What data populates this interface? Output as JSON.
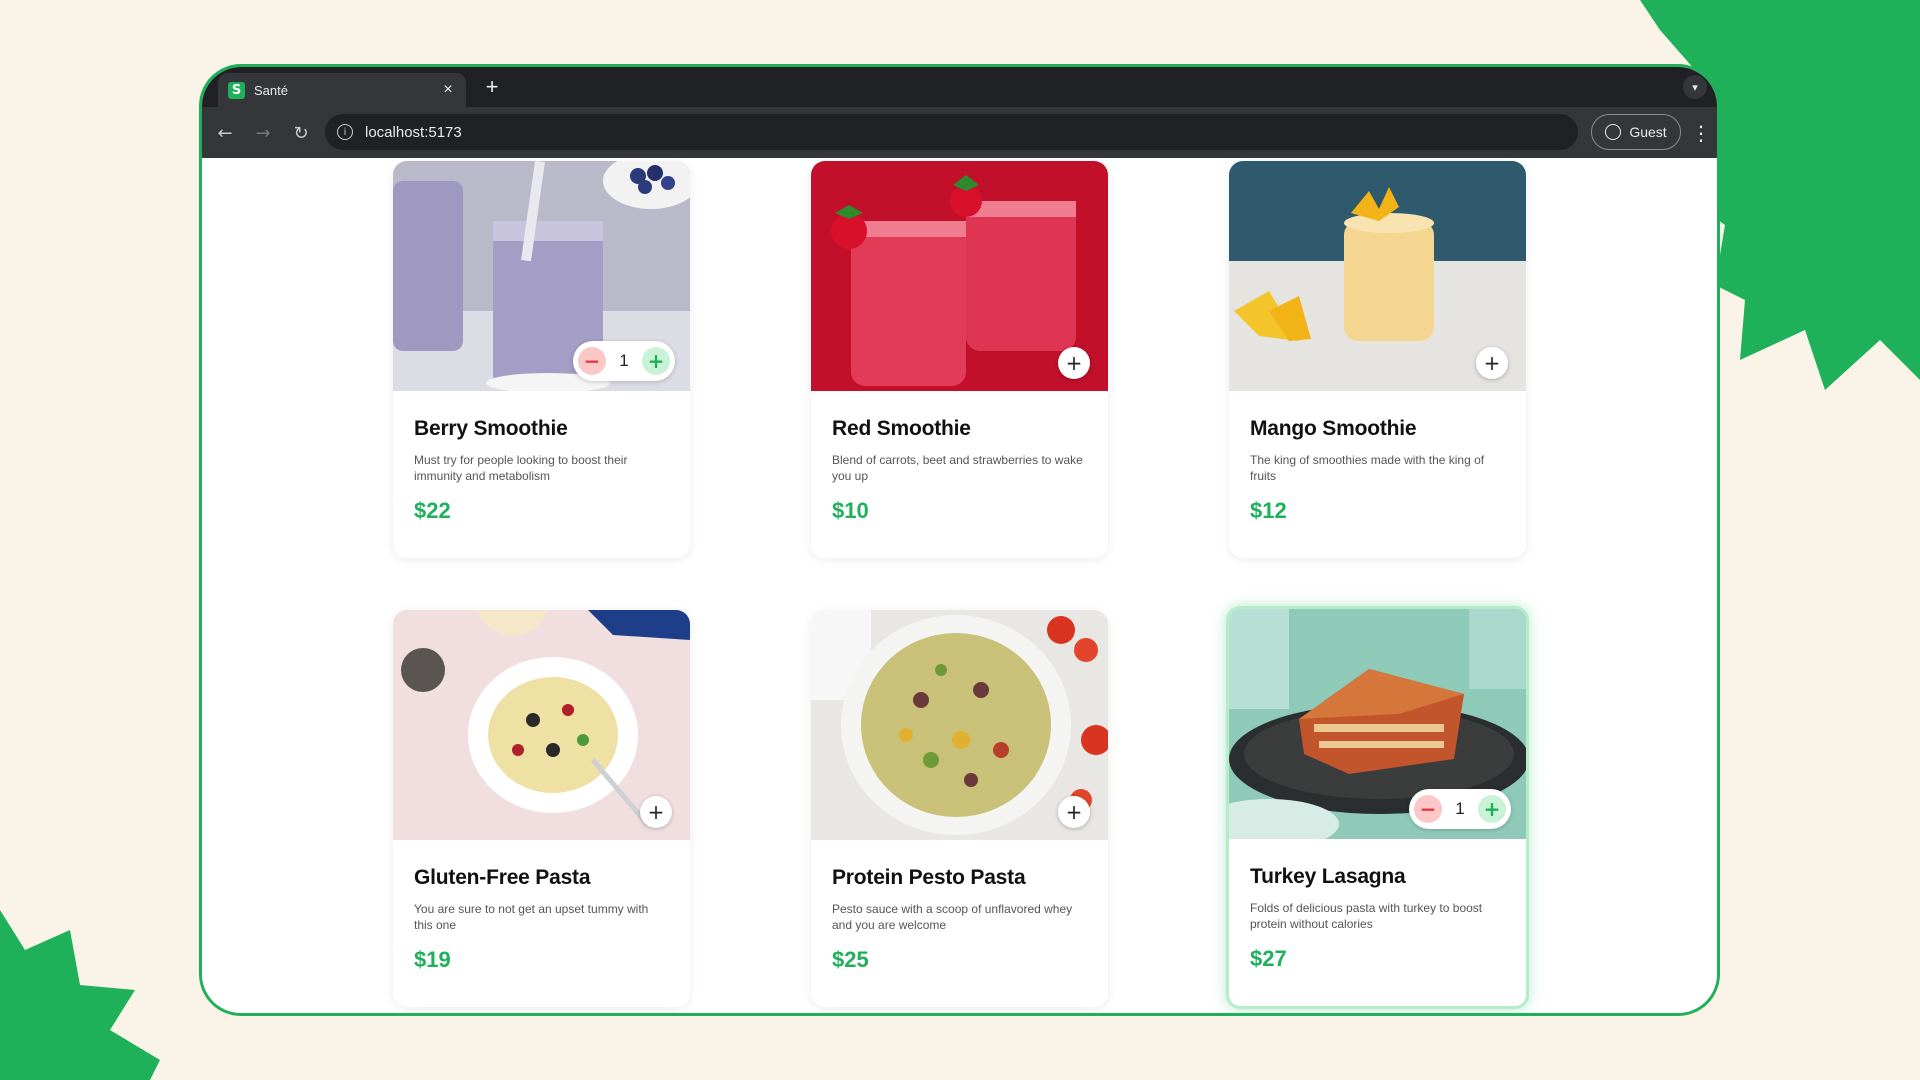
{
  "browser": {
    "tab_title": "Santé",
    "favicon_letter": "S",
    "tab_close": "×",
    "new_tab": "+",
    "url": "localhost:5173",
    "guest_label": "Guest"
  },
  "colors": {
    "accent": "#1fb15a",
    "background": "#faf3e7",
    "minus_bg": "#fbc7c7",
    "plus_bg": "#c9f2d6"
  },
  "products": [
    {
      "name": "Berry Smoothie",
      "description": "Must try for people looking to boost their immunity and metabolism",
      "price": "$22",
      "quantity": "1",
      "in_cart": true,
      "image": "berry-smoothie-image"
    },
    {
      "name": "Red Smoothie",
      "description": "Blend of carrots, beet and strawberries to wake you up",
      "price": "$10",
      "in_cart": false,
      "image": "red-smoothie-image"
    },
    {
      "name": "Mango Smoothie",
      "description": "The king of smoothies made with the king of fruits",
      "price": "$12",
      "in_cart": false,
      "image": "mango-smoothie-image"
    },
    {
      "name": "Gluten-Free Pasta",
      "description": "You are sure to not get an upset tummy with this one",
      "price": "$19",
      "in_cart": false,
      "image": "pasta-salad-image"
    },
    {
      "name": "Protein Pesto Pasta",
      "description": "Pesto sauce with a scoop of unflavored whey and you are welcome",
      "price": "$25",
      "in_cart": false,
      "image": "pesto-pasta-image"
    },
    {
      "name": "Turkey Lasagna",
      "description": "Folds of delicious pasta with turkey to boost protein without calories",
      "price": "$27",
      "quantity": "1",
      "in_cart": true,
      "image": "lasagna-image"
    }
  ]
}
